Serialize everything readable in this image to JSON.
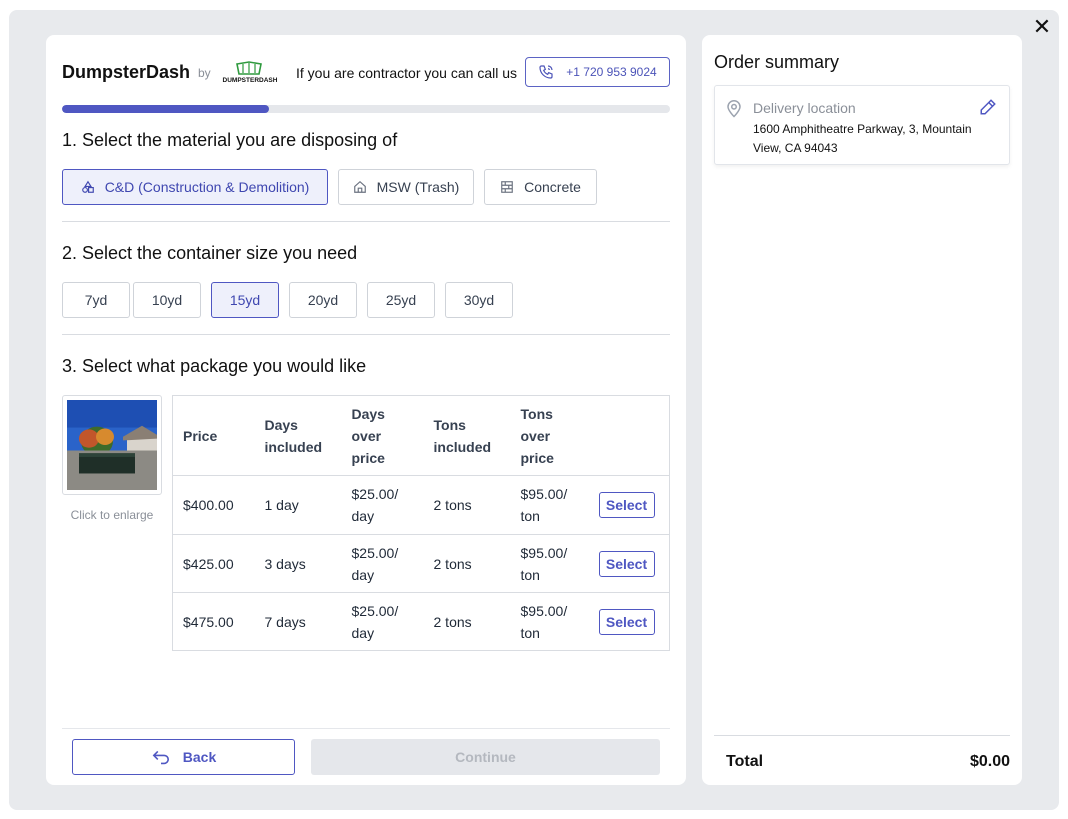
{
  "header": {
    "brand": "DumpsterDash",
    "by": "by",
    "logo_text": "DUMPSTERDASH",
    "call_text": "If you are contractor you can call us",
    "phone": "+1 720 953 9024"
  },
  "progress": {
    "fraction": 0.34
  },
  "step1": {
    "title": "1. Select the material you are disposing of",
    "materials": [
      {
        "label": "C&D (Construction & Demolition)",
        "icon": "shapes-icon",
        "selected": true
      },
      {
        "label": "MSW (Trash)",
        "icon": "house-icon",
        "selected": false
      },
      {
        "label": "Concrete",
        "icon": "bricks-icon",
        "selected": false
      }
    ]
  },
  "step2": {
    "title": "2. Select the container size you need",
    "sizes": [
      {
        "label": "7yd",
        "selected": false
      },
      {
        "label": "10yd",
        "selected": false
      },
      {
        "label": "15yd",
        "selected": true
      },
      {
        "label": "20yd",
        "selected": false
      },
      {
        "label": "25yd",
        "selected": false
      },
      {
        "label": "30yd",
        "selected": false
      }
    ]
  },
  "step3": {
    "title": "3. Select what package you would like",
    "enlarge": "Click to enlarge",
    "headers": {
      "price": "Price",
      "days_included": "Days included",
      "days_over": "Days over price",
      "tons_included": "Tons included",
      "tons_over": "Tons over price"
    },
    "rows": [
      {
        "price": "$400.00",
        "days": "1 day",
        "days_over": "$25.00/ day",
        "tons": "2 tons",
        "tons_over": "$95.00/ ton",
        "action": "Select"
      },
      {
        "price": "$425.00",
        "days": "3 days",
        "days_over": "$25.00/ day",
        "tons": "2 tons",
        "tons_over": "$95.00/ ton",
        "action": "Select"
      },
      {
        "price": "$475.00",
        "days": "7 days",
        "days_over": "$25.00/ day",
        "tons": "2 tons",
        "tons_over": "$95.00/ ton",
        "action": "Select"
      }
    ]
  },
  "footer": {
    "back": "Back",
    "continue": "Continue"
  },
  "summary": {
    "title": "Order summary",
    "location_label": "Delivery location",
    "location_address": "1600 Amphitheatre Parkway, 3, Mountain View, CA 94043",
    "total_label": "Total",
    "total_value": "$0.00"
  },
  "colors": {
    "accent": "#4f57c2",
    "selected_bg": "#eef0fb",
    "disabled_bg": "#e5e7eb"
  }
}
